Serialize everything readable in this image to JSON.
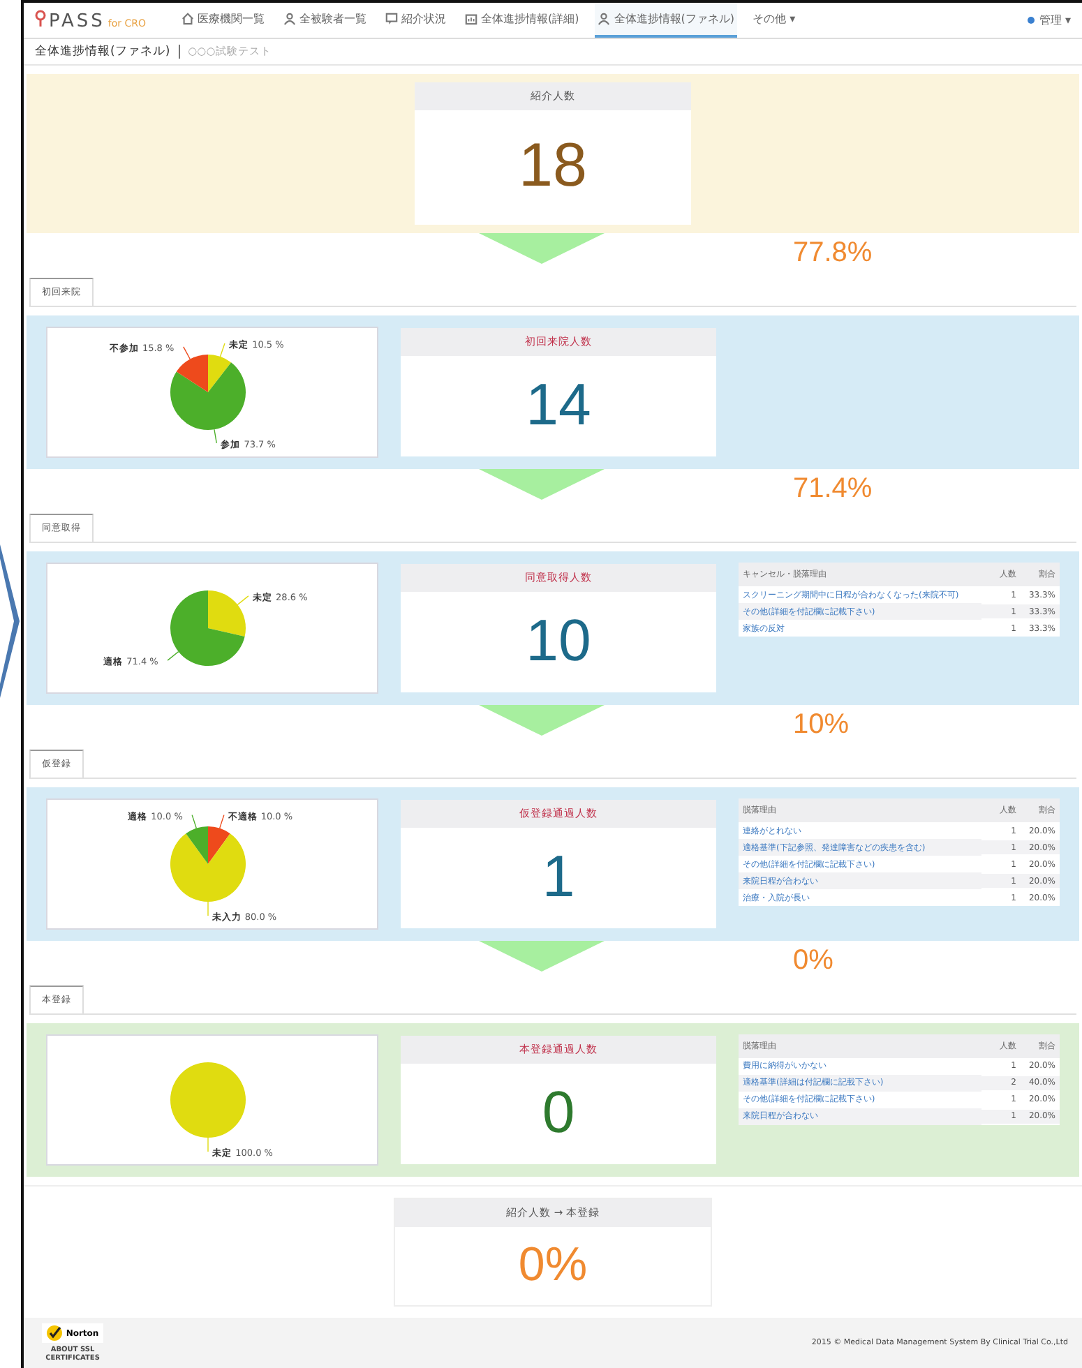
{
  "nav": {
    "logo": "PASS",
    "logo_sub": "for CRO",
    "items": [
      {
        "label": "医療機関一覧",
        "selected": false
      },
      {
        "label": "全被験者一覧",
        "selected": false
      },
      {
        "label": "紹介状況",
        "selected": false
      },
      {
        "label": "全体進捗情報(詳細)",
        "selected": false
      },
      {
        "label": "全体進捗情報(ファネル)",
        "selected": true
      },
      {
        "label": "その他 ▾",
        "selected": false
      }
    ],
    "user": "管理 ▾"
  },
  "breadcrumb": {
    "title": "全体進捗情報(ファネル)",
    "subtitle": "○○○試験テスト"
  },
  "top_stage": {
    "kind": "referral",
    "title": "紹介人数",
    "count": "18"
  },
  "stages": [
    {
      "conversion": "77.8%",
      "tab": "初回来院",
      "kind": "progress",
      "title": "初回来院人数",
      "count": "14",
      "chart_data": {
        "type": "pie",
        "categories": [
          "未定",
          "参加",
          "不参加"
        ],
        "values": [
          10.5,
          73.7,
          15.8
        ],
        "value_labels": [
          "10.5 %",
          "73.7 %",
          "15.8 %"
        ],
        "colors": [
          "#e0dc10",
          "#4caf2a",
          "#ee4a1c"
        ]
      }
    },
    {
      "conversion": "71.4%",
      "tab": "同意取得",
      "kind": "progress",
      "title": "同意取得人数",
      "count": "10",
      "chart_data": {
        "type": "pie",
        "categories": [
          "未定",
          "適格"
        ],
        "values": [
          28.6,
          71.4
        ],
        "value_labels": [
          "28.6 %",
          "71.4 %"
        ],
        "colors": [
          "#e0dc10",
          "#4caf2a"
        ]
      },
      "table": {
        "columns": [
          "キャンセル・脱落理由",
          "人数",
          "割合"
        ],
        "rows": [
          [
            "スクリーニング期間中に日程が合わなくなった(来院不可)",
            "1",
            "33.3%"
          ],
          [
            "その他(詳細を付記欄に記載下さい)",
            "1",
            "33.3%"
          ],
          [
            "家族の反対",
            "1",
            "33.3%"
          ]
        ]
      }
    },
    {
      "conversion": "10%",
      "tab": "仮登録",
      "kind": "progress",
      "title": "仮登録通過人数",
      "count": "1",
      "chart_data": {
        "type": "pie",
        "categories": [
          "不適格",
          "未入力",
          "適格"
        ],
        "values": [
          10.0,
          80.0,
          10.0
        ],
        "value_labels": [
          "10.0 %",
          "80.0 %",
          "10.0 %"
        ],
        "colors": [
          "#ee4a1c",
          "#e0dc10",
          "#4caf2a"
        ]
      },
      "table": {
        "columns": [
          "脱落理由",
          "人数",
          "割合"
        ],
        "rows": [
          [
            "連絡がとれない",
            "1",
            "20.0%"
          ],
          [
            "適格基準(下記参照、発達障害などの疾患を含む)",
            "1",
            "20.0%"
          ],
          [
            "その他(詳細を付記欄に記載下さい)",
            "1",
            "20.0%"
          ],
          [
            "来院日程が合わない",
            "1",
            "20.0%"
          ],
          [
            "治療・入院が長い",
            "1",
            "20.0%"
          ]
        ]
      }
    },
    {
      "conversion": "0%",
      "tab": "本登録",
      "kind": "registered",
      "title": "本登録通過人数",
      "count": "0",
      "chart_data": {
        "type": "pie",
        "categories": [
          "未定"
        ],
        "values": [
          100.0
        ],
        "value_labels": [
          "100.0 %"
        ],
        "colors": [
          "#e0dc10"
        ]
      },
      "table": {
        "columns": [
          "脱落理由",
          "人数",
          "割合"
        ],
        "rows": [
          [
            "費用に納得がいかない",
            "1",
            "20.0%"
          ],
          [
            "適格基準(詳細は付記欄に記載下さい)",
            "2",
            "40.0%"
          ],
          [
            "その他(詳細を付記欄に記載下さい)",
            "1",
            "20.0%"
          ],
          [
            "来院日程が合わない",
            "1",
            "20.0%"
          ]
        ]
      }
    }
  ],
  "summary": {
    "title": "紹介人数 → 本登録",
    "value": "0%"
  },
  "footer": {
    "seal_name": "Norton",
    "seal_caption": "ABOUT SSL CERTIFICATES",
    "copyright": "2015 © Medical Data Management System By Clinical Trial Co.,Ltd"
  }
}
